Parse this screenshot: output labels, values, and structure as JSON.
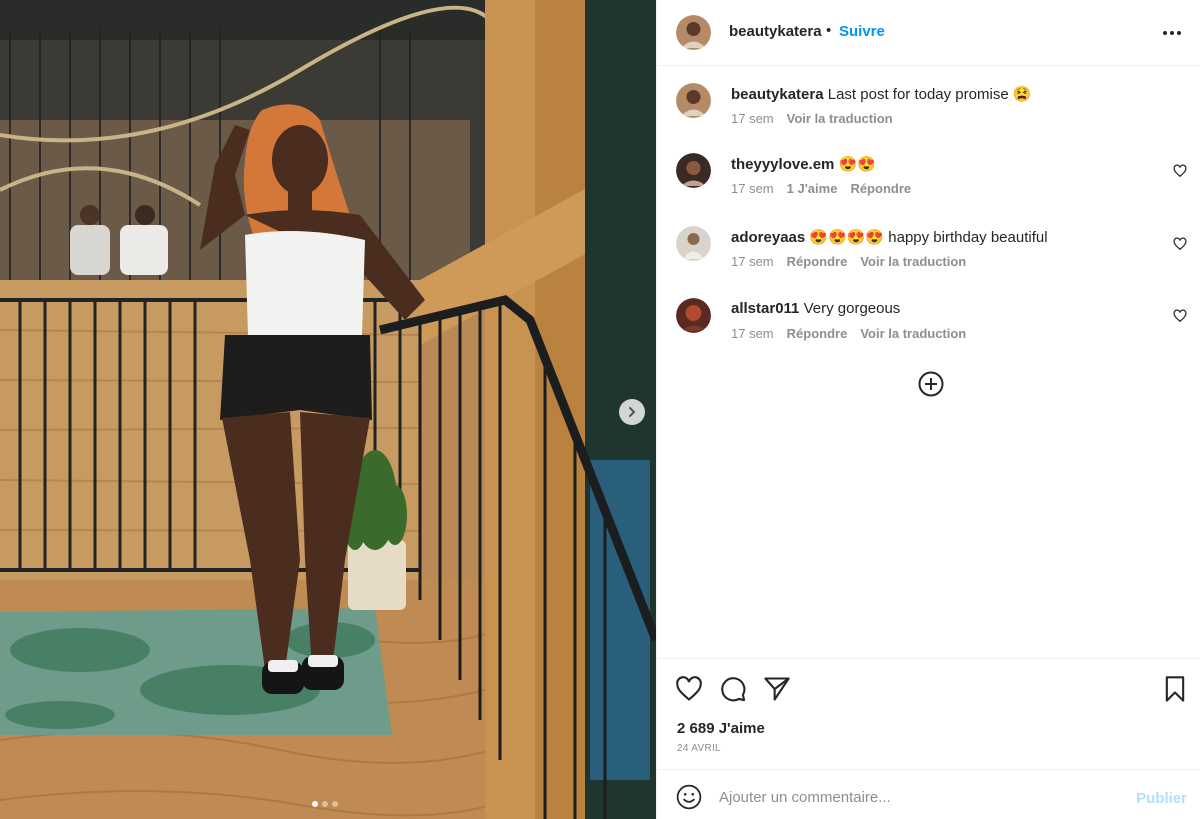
{
  "post": {
    "author": "beautykatera",
    "follow_label": "Suivre",
    "separator": "•",
    "image_alt": "Photo de la publication",
    "carousel": {
      "count": 3,
      "active": 1
    }
  },
  "caption": {
    "user": "beautykatera",
    "text": "Last post for today promise 😫",
    "time": "17 sem",
    "translate": "Voir la traduction"
  },
  "comments": [
    {
      "user": "theyyylove.em",
      "text": "😍😍",
      "time": "17 sem",
      "likes": "1 J'aime",
      "reply": "Répondre",
      "translate": ""
    },
    {
      "user": "adoreyaas",
      "text": "😍😍😍😍 happy birthday beautiful",
      "time": "17 sem",
      "likes": "",
      "reply": "Répondre",
      "translate": "Voir la traduction"
    },
    {
      "user": "allstar011",
      "text": "Very gorgeous",
      "time": "17 sem",
      "likes": "",
      "reply": "Répondre",
      "translate": "Voir la traduction"
    }
  ],
  "actions": {
    "likes_count": "2 689 J'aime",
    "date": "24 AVRIL"
  },
  "composer": {
    "placeholder": "Ajouter un commentaire...",
    "publish_label": "Publier"
  },
  "icons": [
    "more-options-icon",
    "heart-icon",
    "comment-icon",
    "share-icon",
    "bookmark-icon",
    "emoji-icon",
    "add-circle-icon",
    "chevron-right-icon"
  ],
  "colors": {
    "accent": "#0095f6",
    "publish_disabled": "#b2dffc",
    "muted": "#8e8e8e",
    "text": "#262626"
  }
}
